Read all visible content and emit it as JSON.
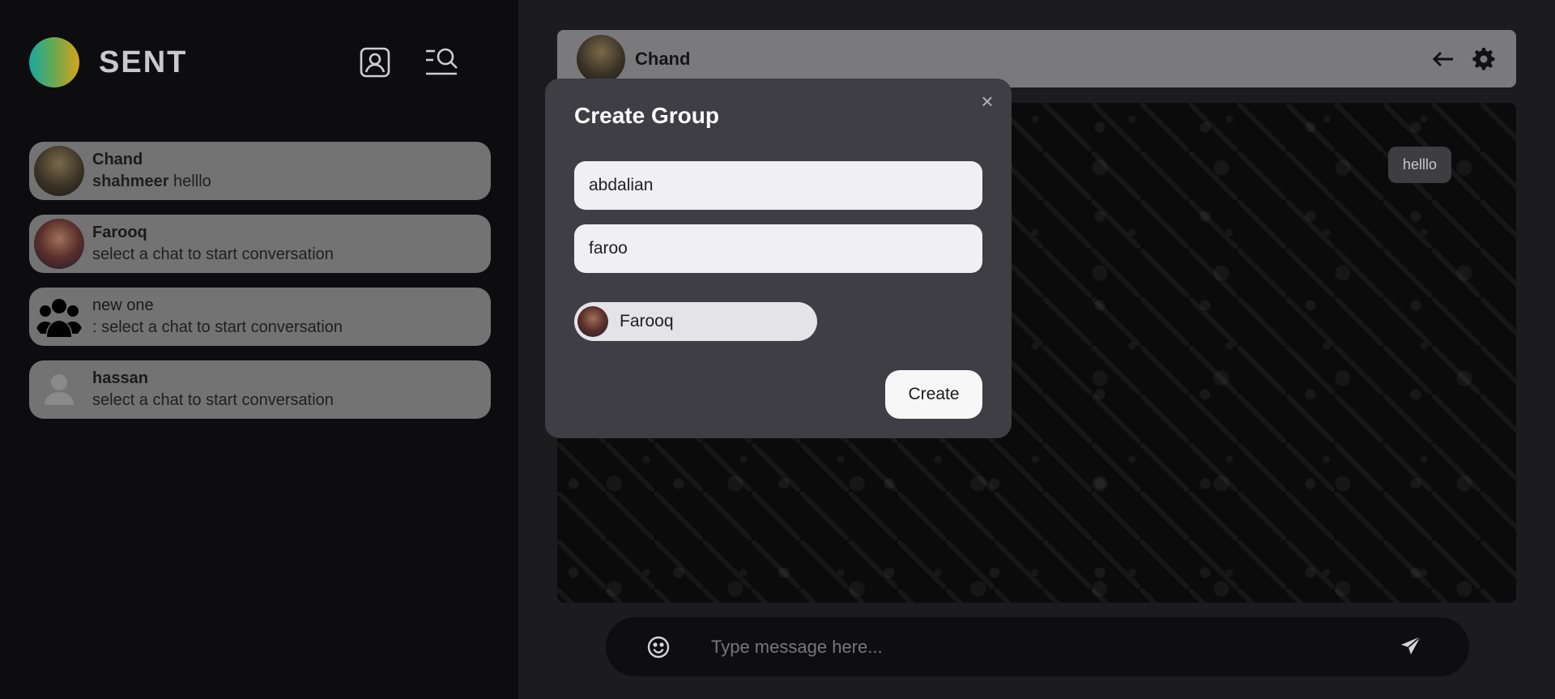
{
  "brand": {
    "name": "SENT",
    "logo_colors": [
      "#1aa7a3",
      "#6aa84f",
      "#d6a21c"
    ]
  },
  "sidebar": {
    "icons": [
      "contacts-icon",
      "search-list-icon"
    ],
    "chats": [
      {
        "name": "Chand",
        "preview_sender": "shahmeer",
        "preview_text": " helllo",
        "avatar": "photo"
      },
      {
        "name": "Farooq",
        "preview_sender": "",
        "preview_text": " select a chat to start conversation",
        "avatar": "photo"
      },
      {
        "name": "new one",
        "preview_sender": "",
        "preview_text": ": select a chat to start conversation",
        "avatar": "group-icon"
      },
      {
        "name": "hassan",
        "preview_sender": "",
        "preview_text": " select a chat to start conversation",
        "avatar": "default-user-icon"
      }
    ]
  },
  "header": {
    "name": "Chand",
    "back_icon": "arrow-left-icon",
    "settings_icon": "gear-icon"
  },
  "messages": [
    {
      "text": "helllo",
      "side": "right"
    }
  ],
  "composer": {
    "placeholder": "Type message here...",
    "emoji_icon": "smile-icon",
    "send_icon": "send-icon"
  },
  "modal": {
    "title": "Create Group",
    "close_label": "×",
    "group_name_value": "abdalian",
    "user_search_value": "faroo",
    "selected_users": [
      {
        "name": "Farooq"
      }
    ],
    "create_label": "Create"
  }
}
